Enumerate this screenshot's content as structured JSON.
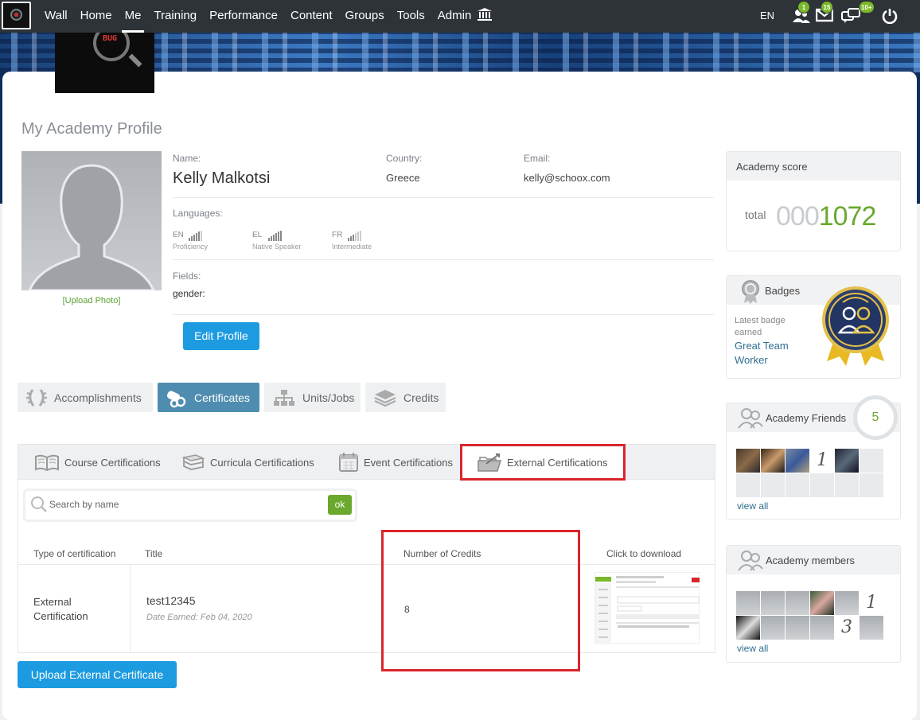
{
  "nav": {
    "items": [
      "Wall",
      "Home",
      "Me",
      "Training",
      "Performance",
      "Content",
      "Groups",
      "Tools",
      "Admin"
    ],
    "active": "Me",
    "lang": "EN",
    "badges": {
      "friends": "1",
      "messages": "15",
      "chat": "10+"
    },
    "icons": [
      "logo-icon",
      "institution-icon",
      "friend-requests-icon",
      "messages-icon",
      "chat-icon",
      "power-icon"
    ]
  },
  "profile": {
    "page_title": "My Academy Profile",
    "upload_photo": "[Upload Photo]",
    "name_label": "Name:",
    "name": "Kelly Malkotsi",
    "country_label": "Country:",
    "country": "Greece",
    "email_label": "Email:",
    "email": "kelly@schoox.com",
    "languages_label": "Languages:",
    "languages": [
      {
        "code": "EN",
        "level": "Proficiency",
        "bars": 5
      },
      {
        "code": "EL",
        "level": "Native Speaker",
        "bars": 6
      },
      {
        "code": "FR",
        "level": "Intermediate",
        "bars": 3
      }
    ],
    "fields_label": "Fields:",
    "gender_label": "gender:",
    "edit_button": "Edit Profile"
  },
  "main_tabs": [
    {
      "label": "Accomplishments",
      "icon": "laurel-icon"
    },
    {
      "label": "Certificates",
      "icon": "diploma-icon",
      "active": true
    },
    {
      "label": "Units/Jobs",
      "icon": "org-chart-icon"
    },
    {
      "label": "Credits",
      "icon": "stack-icon"
    }
  ],
  "sub_tabs": [
    {
      "label": "Course Certifications",
      "icon": "open-book-icon"
    },
    {
      "label": "Curricula Certifications",
      "icon": "books-icon"
    },
    {
      "label": "Event Certifications",
      "icon": "calendar-icon"
    },
    {
      "label": "External Certifications",
      "icon": "folder-icon",
      "active": true
    }
  ],
  "search": {
    "placeholder": "Search by name",
    "ok": "ok"
  },
  "table": {
    "headers": [
      "Type of certification",
      "Title",
      "Number of Credits",
      "Click to download"
    ],
    "rows": [
      {
        "type": "External Certification",
        "title": "test12345",
        "date": "Date Earned: Feb 04, 2020",
        "credits": "8"
      }
    ]
  },
  "upload_button": "Upload External Certificate",
  "sidebar": {
    "score": {
      "title": "Academy score",
      "total_label": "total",
      "padding": "000",
      "value": "1072"
    },
    "badges": {
      "title": "Badges",
      "latest_label": "Latest badge earned",
      "latest_name": "Great Team Worker"
    },
    "friends": {
      "title": "Academy Friends",
      "count": "5",
      "view_all": "view all"
    },
    "members": {
      "title": "Academy members",
      "view_all": "view all"
    }
  },
  "colors": {
    "nav_bg": "#2e3338",
    "accent_blue": "#1d9be0",
    "active_tab": "#4f8db0",
    "green": "#6aa82e",
    "highlight_red": "#d9262c"
  }
}
